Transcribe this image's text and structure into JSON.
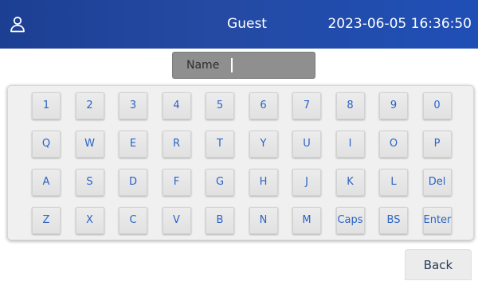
{
  "header": {
    "user_icon": "user-icon",
    "title": "Guest",
    "datetime": "2023-06-05 16:36:50"
  },
  "name_input": {
    "label": "Name",
    "value": ""
  },
  "keyboard": {
    "rows": [
      [
        "1",
        "2",
        "3",
        "4",
        "5",
        "6",
        "7",
        "8",
        "9",
        "0"
      ],
      [
        "Q",
        "W",
        "E",
        "R",
        "T",
        "Y",
        "U",
        "I",
        "O",
        "P"
      ],
      [
        "A",
        "S",
        "D",
        "F",
        "G",
        "H",
        "J",
        "K",
        "L",
        "Del"
      ],
      [
        "Z",
        "X",
        "C",
        "V",
        "B",
        "N",
        "M",
        "Caps",
        "BS",
        "Enter"
      ]
    ]
  },
  "back_button": {
    "label": "Back"
  },
  "colors": {
    "header_start": "#1c3f93",
    "header_end": "#1f4fb6",
    "key_text": "#2b63c8",
    "name_field": "#8f8f8f"
  }
}
